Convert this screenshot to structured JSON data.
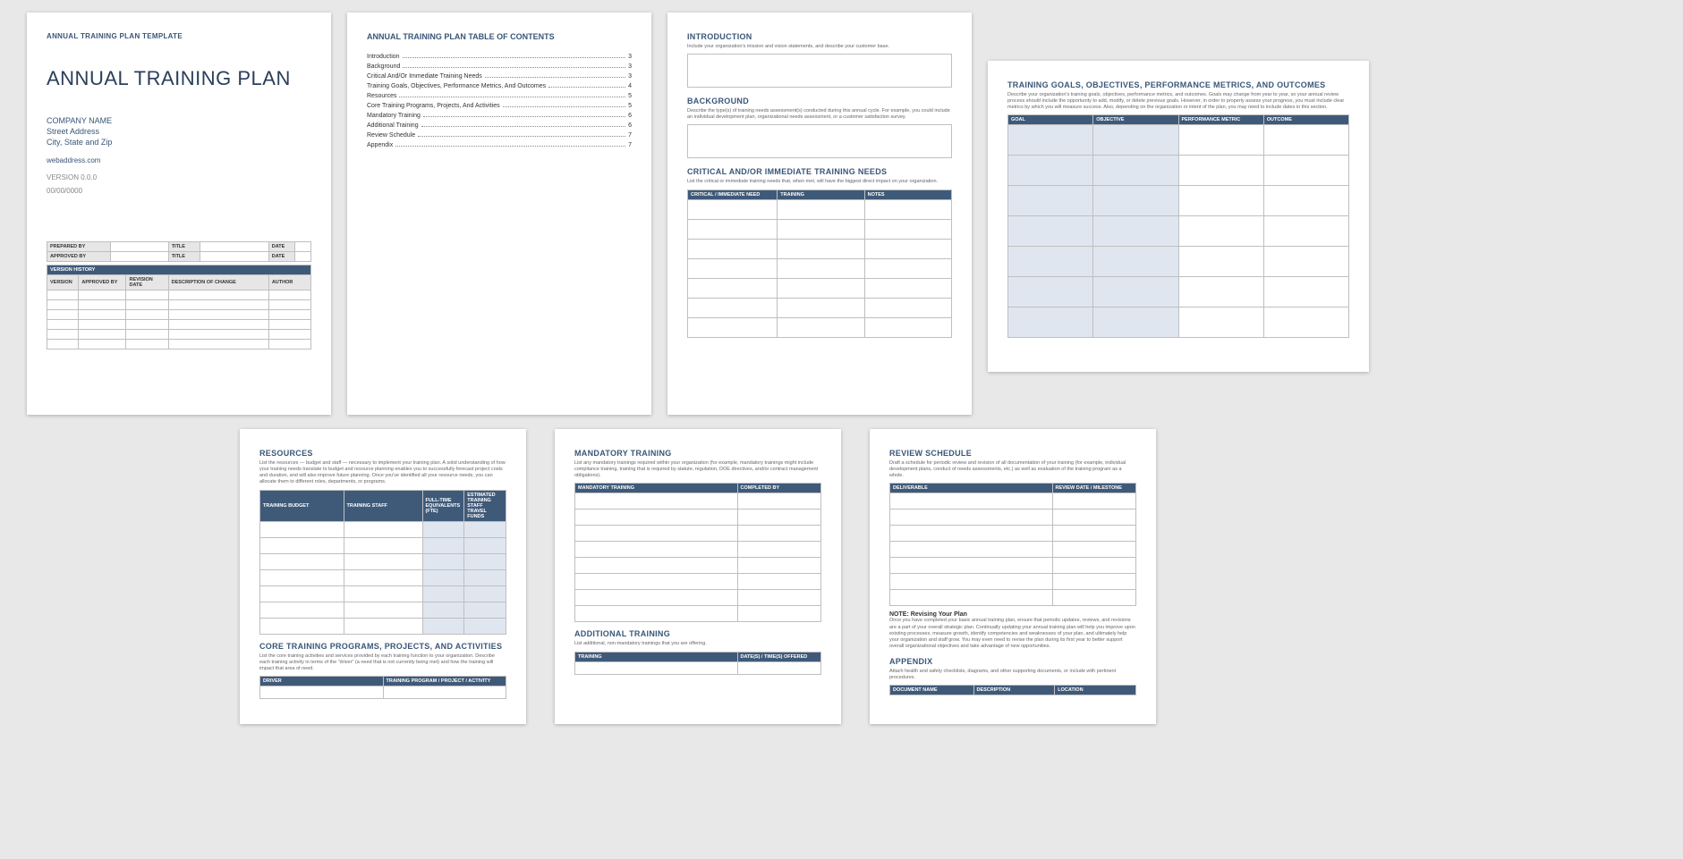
{
  "page1": {
    "header": "ANNUAL TRAINING PLAN TEMPLATE",
    "title": "ANNUAL TRAINING PLAN",
    "company_name": "COMPANY NAME",
    "street": "Street Address",
    "city": "City, State and Zip",
    "web": "webaddress.com",
    "version": "VERSION 0.0.0",
    "date": "00/00/0000",
    "prep_by": "PREPARED BY",
    "app_by": "APPROVED BY",
    "title_lbl": "TITLE",
    "date_lbl": "DATE",
    "vh_header": "VERSION HISTORY",
    "vh_cols": {
      "version": "VERSION",
      "approved": "APPROVED BY",
      "revdate": "REVISION DATE",
      "desc": "DESCRIPTION OF CHANGE",
      "author": "AUTHOR"
    }
  },
  "page2": {
    "title": "ANNUAL TRAINING PLAN TABLE OF CONTENTS",
    "items": [
      {
        "label": "Introduction",
        "pg": "3"
      },
      {
        "label": "Background",
        "pg": "3"
      },
      {
        "label": "Critical And/Or Immediate Training Needs",
        "pg": "3"
      },
      {
        "label": "Training Goals, Objectives, Performance Metrics, And Outcomes",
        "pg": "4"
      },
      {
        "label": "Resources",
        "pg": "5"
      },
      {
        "label": "Core Training Programs, Projects, And Activities",
        "pg": "5"
      },
      {
        "label": "Mandatory Training",
        "pg": "6"
      },
      {
        "label": "Additional Training",
        "pg": "6"
      },
      {
        "label": "Review Schedule",
        "pg": "7"
      },
      {
        "label": "Appendix",
        "pg": "7"
      }
    ]
  },
  "page3": {
    "intro_h": "INTRODUCTION",
    "intro_d": "Include your organization's mission and vision statements, and describe your customer base.",
    "back_h": "BACKGROUND",
    "back_d": "Describe the type(s) of training needs assessment(s) conducted during this annual cycle. For example, you could include an individual development plan, organizational needs assessment, or a customer satisfaction survey.",
    "crit_h": "CRITICAL AND/OR IMMEDIATE TRAINING NEEDS",
    "crit_d": "List the critical or immediate training needs that, when met, will have the biggest direct impact on your organization.",
    "crit_cols": {
      "need": "CRITICAL / IMMEDIATE NEED",
      "training": "TRAINING",
      "notes": "NOTES"
    }
  },
  "page4": {
    "title": "TRAINING GOALS, OBJECTIVES, PERFORMANCE METRICS, AND OUTCOMES",
    "desc": "Describe your organization's training goals, objectives, performance metrics, and outcomes. Goals may change from year to year, so your annual review process should include the opportunity to add, modify, or delete previous goals. However, in order to properly assess your progress, you must include clear metrics by which you will measure success. Also, depending on the organization or intent of the plan, you may need to include dates in this section.",
    "cols": {
      "goal": "GOAL",
      "objective": "OBJECTIVE",
      "metric": "PERFORMANCE METRIC",
      "outcome": "OUTCOME"
    }
  },
  "page5": {
    "res_h": "RESOURCES",
    "res_d": "List the resources — budget and staff — necessary to implement your training plan. A solid understanding of how your training needs translate to budget and resource planning enables you to successfully forecast project costs and duration, and will also improve future planning. Once you've identified all your resource needs, you can allocate them to different roles, departments, or programs.",
    "res_cols": {
      "budget": "TRAINING BUDGET",
      "staff": "TRAINING STAFF",
      "fte": "FULL-TIME EQUIVALENTS (FTE)",
      "travel": "ESTIMATED TRAINING STAFF TRAVEL FUNDS"
    },
    "core_h": "CORE TRAINING PROGRAMS, PROJECTS, AND ACTIVITIES",
    "core_d": "List the core training activities and services provided by each training function to your organization. Describe each training activity in terms of the \"driver\" (a need that is not currently being met) and how the training will impact that area of need.",
    "core_cols": {
      "driver": "DRIVER",
      "program": "TRAINING PROGRAM / PROJECT / ACTIVITY"
    }
  },
  "page6": {
    "man_h": "MANDATORY TRAINING",
    "man_d": "List any mandatory trainings required within your organization (for example, mandatory trainings might include compliance training, training that is required by statute, regulation, DOE directives, and/or contract management obligations).",
    "man_cols": {
      "training": "MANDATORY TRAINING",
      "completed": "COMPLETED BY"
    },
    "add_h": "ADDITIONAL TRAINING",
    "add_d": "List additional, non-mandatory trainings that you are offering.",
    "add_cols": {
      "training": "TRAINING",
      "dates": "DATE(S) / TIME(S) OFFERED"
    }
  },
  "page7": {
    "rev_h": "REVIEW SCHEDULE",
    "rev_d": "Draft a schedule for periodic review and revision of all documentation of your training (for example, individual development plans, conduct of needs assessments, etc.) as well as evaluation of the training program as a whole.",
    "rev_cols": {
      "deliverable": "DELIVERABLE",
      "date": "REVIEW DATE / MILESTONE"
    },
    "note_h": "NOTE: Revising Your Plan",
    "note_d": "Once you have completed your basic annual training plan, ensure that periodic updates, reviews, and revisions are a part of your overall strategic plan. Continually updating your annual training plan will help you improve upon existing processes, measure growth, identify competencies and weaknesses of your plan, and ultimately help your organization and staff grow. You may even need to revise the plan during its first year to better support overall organizational objectives and take advantage of new opportunities.",
    "app_h": "APPENDIX",
    "app_d": "Attach health and safety checklists, diagrams, and other supporting documents, or include with pertinent procedures.",
    "app_cols": {
      "name": "DOCUMENT NAME",
      "desc": "DESCRIPTION",
      "loc": "LOCATION"
    }
  }
}
